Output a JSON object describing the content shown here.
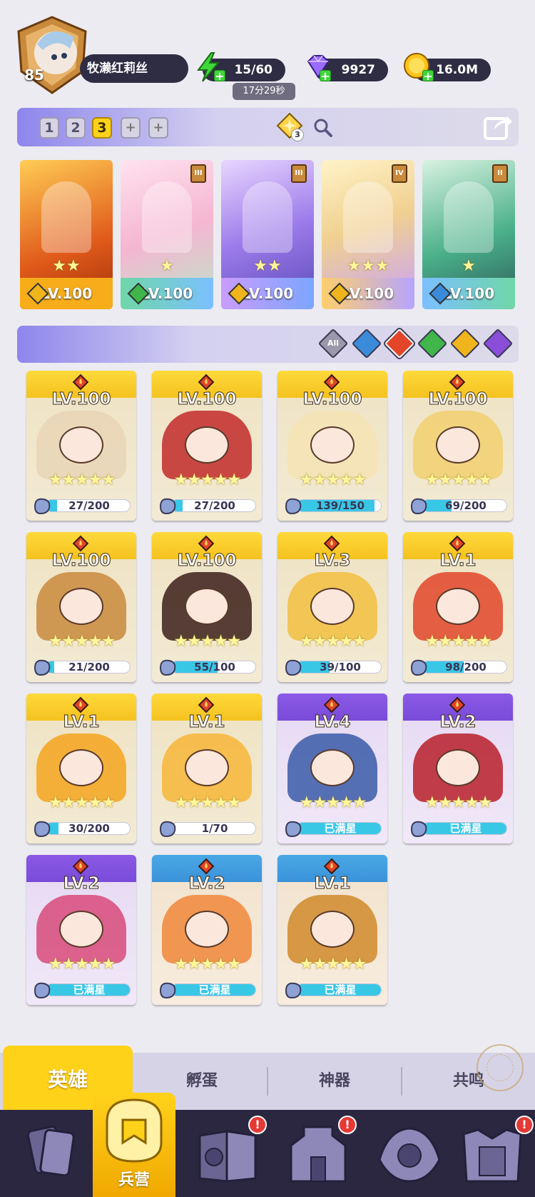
{
  "player": {
    "level": "85",
    "name": "牧濑红莉丝"
  },
  "resources": {
    "energy": "15/60",
    "energy_timer": "17分29秒",
    "gems": "9927",
    "gold": "16.0M"
  },
  "team_bar": {
    "tabs": [
      "1",
      "2",
      "3",
      "+",
      "+"
    ],
    "active_tab": "3",
    "formation_count": "3"
  },
  "lineup": [
    {
      "level": "LV.100",
      "stars": "★★",
      "element": "light",
      "rank": ""
    },
    {
      "level": "LV.100",
      "stars": "★",
      "element": "nature",
      "rank": "III"
    },
    {
      "level": "LV.100",
      "stars": "★★",
      "element": "light",
      "rank": "III"
    },
    {
      "level": "LV.100",
      "stars": "★★★",
      "element": "light",
      "rank": "IV"
    },
    {
      "level": "LV.100",
      "stars": "★",
      "element": "water",
      "rank": "II"
    }
  ],
  "filters": {
    "all_label": "All",
    "elements": [
      "all",
      "water",
      "fire",
      "nature",
      "light",
      "dark"
    ],
    "active": "fire"
  },
  "heroes": [
    {
      "level": "LV.100",
      "stars": "★★★★★",
      "progress": "27/200",
      "fill": 0.135,
      "frame": "gold"
    },
    {
      "level": "LV.100",
      "stars": "★★★★★",
      "progress": "27/200",
      "fill": 0.135,
      "frame": "gold"
    },
    {
      "level": "LV.100",
      "stars": "★★★★★",
      "progress": "139/150",
      "fill": 0.927,
      "frame": "gold"
    },
    {
      "level": "LV.100",
      "stars": "★★★★★",
      "progress": "69/200",
      "fill": 0.345,
      "frame": "gold"
    },
    {
      "level": "LV.100",
      "stars": "★★★★★",
      "progress": "21/200",
      "fill": 0.105,
      "frame": "gold"
    },
    {
      "level": "LV.100",
      "stars": "★★★★★",
      "progress": "55/100",
      "fill": 0.55,
      "frame": "gold"
    },
    {
      "level": "LV.3",
      "stars": "★★★★★",
      "progress": "39/100",
      "fill": 0.39,
      "frame": "gold"
    },
    {
      "level": "LV.1",
      "stars": "★★★★★",
      "progress": "98/200",
      "fill": 0.49,
      "frame": "gold"
    },
    {
      "level": "LV.1",
      "stars": "★★★★★",
      "progress": "30/200",
      "fill": 0.15,
      "frame": "gold"
    },
    {
      "level": "LV.1",
      "stars": "★★★★★",
      "progress": "1/70",
      "fill": 0.014,
      "frame": "gold"
    },
    {
      "level": "LV.4",
      "stars": "★★★★★",
      "progress": "已满星",
      "fill": 1,
      "frame": "purple"
    },
    {
      "level": "LV.2",
      "stars": "★★★★★",
      "progress": "已满星",
      "fill": 1,
      "frame": "purple"
    },
    {
      "level": "LV.2",
      "stars": "★★★★★",
      "progress": "已满星",
      "fill": 1,
      "frame": "purple"
    },
    {
      "level": "LV.2",
      "stars": "★★★★★",
      "progress": "已满星",
      "fill": 1,
      "frame": "blue"
    },
    {
      "level": "LV.1",
      "stars": "★★★★★",
      "progress": "已满星",
      "fill": 1,
      "frame": "blue"
    }
  ],
  "sub_tabs": [
    "英雄",
    "孵蛋",
    "神器",
    "共鸣"
  ],
  "bottom_nav": {
    "active_label": "兵营",
    "items": [
      "cards",
      "barracks",
      "journal",
      "castle",
      "summon",
      "gear"
    ]
  }
}
